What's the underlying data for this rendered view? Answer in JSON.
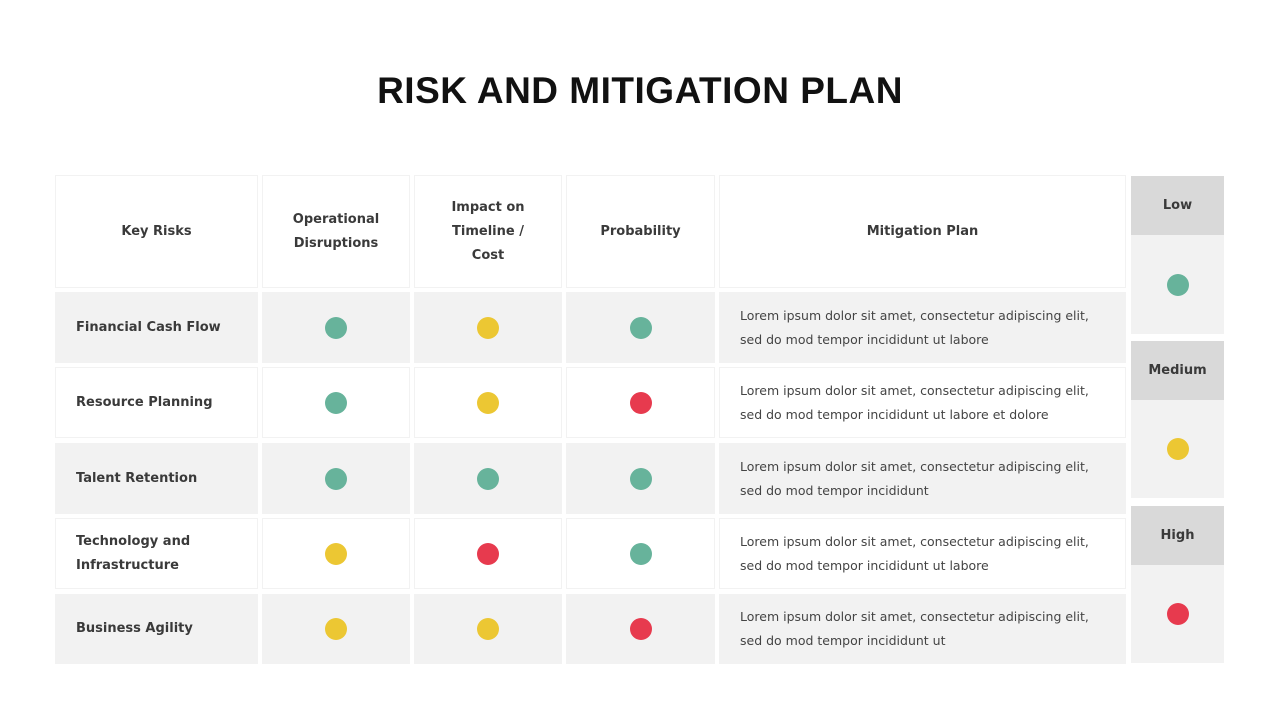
{
  "title": "RISK AND MITIGATION PLAN",
  "colors": {
    "low": "#67b39b",
    "medium": "#ecc733",
    "high": "#e73a4e"
  },
  "table": {
    "headers": {
      "key_risks": "Key Risks",
      "operational": "Operational Disruptions",
      "impact": "Impact on Timeline / Cost",
      "probability": "Probability",
      "mitigation": "Mitigation Plan"
    },
    "rows": [
      {
        "risk": "Financial Cash Flow",
        "operational": "low",
        "impact": "medium",
        "probability": "low",
        "mitigation": "Lorem ipsum dolor sit amet, consectetur adipiscing elit, sed do mod tempor incididunt ut labore"
      },
      {
        "risk": "Resource Planning",
        "operational": "low",
        "impact": "medium",
        "probability": "high",
        "mitigation": "Lorem ipsum dolor sit amet, consectetur adipiscing elit, sed do mod tempor incididunt ut labore et dolore"
      },
      {
        "risk": "Talent Retention",
        "operational": "low",
        "impact": "low",
        "probability": "low",
        "mitigation": "Lorem ipsum dolor sit amet, consectetur adipiscing elit, sed do mod tempor incididunt"
      },
      {
        "risk": "Technology and Infrastructure",
        "operational": "medium",
        "impact": "high",
        "probability": "low",
        "mitigation": "Lorem ipsum dolor sit amet, consectetur adipiscing elit, sed do mod tempor incididunt ut labore"
      },
      {
        "risk": "Business Agility",
        "operational": "medium",
        "impact": "medium",
        "probability": "high",
        "mitigation": "Lorem ipsum dolor sit amet, consectetur adipiscing elit, sed do mod tempor incididunt ut"
      }
    ]
  },
  "legend": [
    {
      "label": "Low",
      "level": "low"
    },
    {
      "label": "Medium",
      "level": "medium"
    },
    {
      "label": "High",
      "level": "high"
    }
  ]
}
